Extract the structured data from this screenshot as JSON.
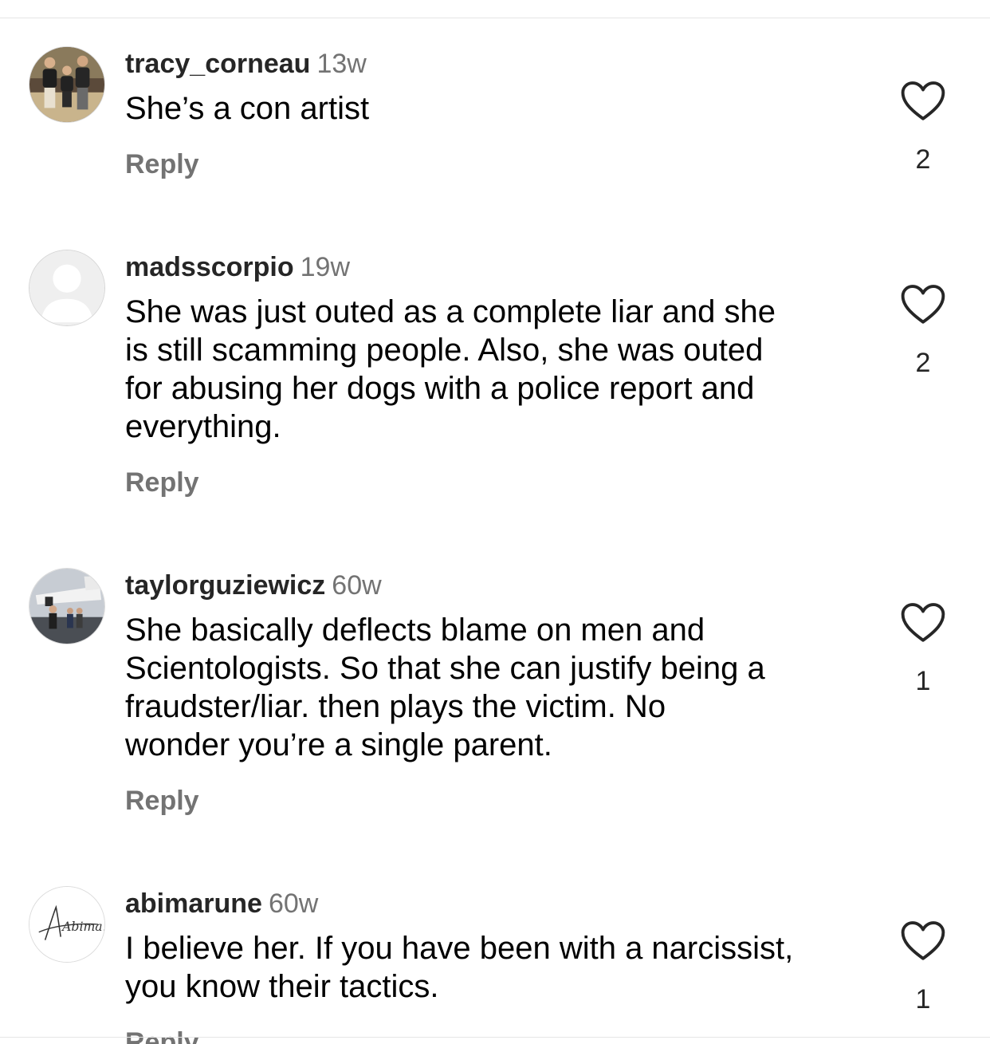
{
  "comments": [
    {
      "username": "tracy_corneau",
      "time": "13w",
      "text": "She’s a con artist",
      "reply_label": "Reply",
      "like_icon": "heart-outline-icon",
      "likes": "2",
      "avatar": "photo-three-people"
    },
    {
      "username": "madsscorpio",
      "time": "19w",
      "text": "She was just outed as a complete liar and she\nis still scamming people. Also, she was outed\nfor abusing her dogs with a police report and\neverything.",
      "reply_label": "Reply",
      "like_icon": "heart-outline-icon",
      "likes": "2",
      "avatar": "default-profile"
    },
    {
      "username": "taylorguziewicz",
      "time": "60w",
      "text": "She basically deflects blame on men and\nScientologists. So that she can justify being a\nfraudster/liar.  then plays the victim.  No\nwonder you’re a single parent.",
      "reply_label": "Reply",
      "like_icon": "heart-outline-icon",
      "likes": "1",
      "avatar": "photo-airplane"
    },
    {
      "username": "abimarune",
      "time": "60w",
      "text": "I believe her. If you have been with a narcissist,\nyou know their tactics.",
      "reply_label": "Reply",
      "like_icon": "heart-outline-icon",
      "likes": "1",
      "avatar": "signature-logo",
      "avatar_text": "Abima."
    }
  ],
  "colors": {
    "username": "#262626",
    "secondary_text": "#737373",
    "divider": "#e6e6e6"
  }
}
